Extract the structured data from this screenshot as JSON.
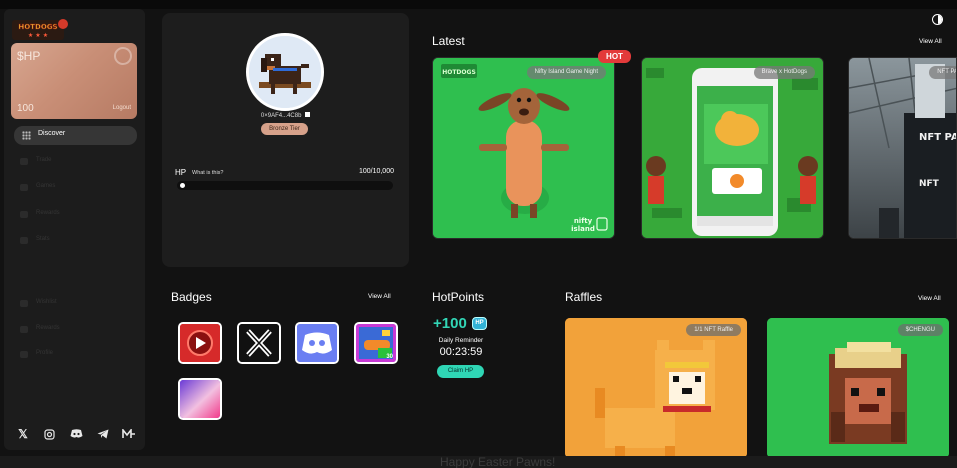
{
  "app": {
    "logo_text": "HOTDOGS"
  },
  "sidebar": {
    "card": {
      "title": "$HP",
      "value": "100",
      "logout_label": "Logout"
    },
    "nav_active": {
      "label": "Discover"
    },
    "nav_items": [
      {
        "label": "Trade"
      },
      {
        "label": "Games"
      },
      {
        "label": "Rewards"
      },
      {
        "label": "Stats"
      },
      {
        "label": "Wishlist"
      },
      {
        "label": "Rewards"
      },
      {
        "label": "Profile"
      }
    ],
    "socials": [
      "x-icon",
      "instagram-icon",
      "discord-icon",
      "telegram-icon",
      "mirror-icon"
    ]
  },
  "profile": {
    "wallet": "0×9AF4...4C8b",
    "tier": "Bronze Tier",
    "hp_label": "HP",
    "hp_what": "What is this?",
    "hp_count": "100/10,000",
    "hp_progress": 0.01
  },
  "latest": {
    "title": "Latest",
    "view_all": "View All",
    "hot_label": "HOT",
    "tiles": [
      {
        "tag": "Nifty Island Game Night",
        "watermark_brand": "nifty island"
      },
      {
        "tag": "Brave x HotDogs"
      },
      {
        "tag": "NFT PA"
      }
    ]
  },
  "badges": {
    "title": "Badges",
    "view_all": "View All",
    "badge_icons": [
      "youtube-badge-icon",
      "x-badge-icon",
      "discord-badge-icon",
      "hotdog-badge-icon",
      "gradient-badge-icon"
    ],
    "hotdog_badge_count": "30"
  },
  "hotpoints": {
    "title": "HotPoints",
    "amount": "+100",
    "chip": "HP",
    "reminder_label": "Daily Reminder",
    "countdown": "00:23:59",
    "claim_label": "Claim HP"
  },
  "raffles": {
    "title": "Raffles",
    "view_all": "View All",
    "items": [
      {
        "tag": "1/1 NFT Raffle"
      },
      {
        "tag": "$CHENGU"
      }
    ]
  },
  "footer": {
    "ghost_text": "Happy Easter Pawns!"
  },
  "colors": {
    "accent": "#32d6b6",
    "card": "#c98f77",
    "hot": "#e33a3a",
    "tile_green": "#2fbf4f"
  }
}
